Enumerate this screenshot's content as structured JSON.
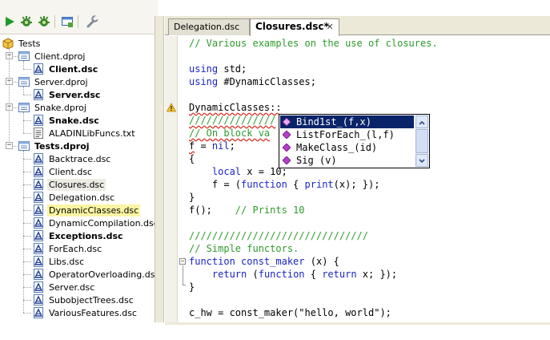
{
  "toolbar": {
    "buttons": [
      {
        "name": "run",
        "icon": "play-icon"
      },
      {
        "name": "debug",
        "icon": "gear-bug-icon"
      },
      {
        "name": "debug2",
        "icon": "gear-bug-icon"
      },
      {
        "name": "window",
        "icon": "window-icon"
      },
      {
        "name": "settings",
        "icon": "wrench-icon"
      }
    ]
  },
  "tree": {
    "items": [
      {
        "label": "Tests",
        "depth": 0,
        "icon": "solution-icon",
        "bold": false,
        "expander": "none"
      },
      {
        "label": "Client.dproj",
        "depth": 1,
        "icon": "project-icon",
        "bold": false,
        "expander": "minus"
      },
      {
        "label": "Client.dsc",
        "depth": 2,
        "icon": "dsc-file-icon",
        "bold": true,
        "expander": "none"
      },
      {
        "label": "Server.dproj",
        "depth": 1,
        "icon": "project-icon",
        "bold": false,
        "expander": "minus"
      },
      {
        "label": "Server.dsc",
        "depth": 2,
        "icon": "dsc-file-icon",
        "bold": true,
        "expander": "none"
      },
      {
        "label": "Snake.dproj",
        "depth": 1,
        "icon": "project-icon",
        "bold": false,
        "expander": "minus"
      },
      {
        "label": "Snake.dsc",
        "depth": 2,
        "icon": "dsc-file-icon",
        "bold": true,
        "expander": "none"
      },
      {
        "label": "ALADINLibFuncs.txt",
        "depth": 2,
        "icon": "text-file-icon",
        "bold": false,
        "expander": "none"
      },
      {
        "label": "Tests.dproj",
        "depth": 1,
        "icon": "project-icon",
        "bold": true,
        "expander": "minus"
      },
      {
        "label": "Backtrace.dsc",
        "depth": 2,
        "icon": "dsc-file-icon",
        "bold": false,
        "expander": "none"
      },
      {
        "label": "Client.dsc",
        "depth": 2,
        "icon": "dsc-file-icon",
        "bold": false,
        "expander": "none"
      },
      {
        "label": "Closures.dsc",
        "depth": 2,
        "icon": "dsc-file-icon",
        "bold": false,
        "expander": "none",
        "state": "selected"
      },
      {
        "label": "Delegation.dsc",
        "depth": 2,
        "icon": "dsc-file-icon",
        "bold": false,
        "expander": "none"
      },
      {
        "label": "DynamicClasses.dsc",
        "depth": 2,
        "icon": "dsc-file-icon",
        "bold": false,
        "expander": "none",
        "state": "highlighted"
      },
      {
        "label": "DynamicCompilation.dsc",
        "depth": 2,
        "icon": "dsc-file-icon",
        "bold": false,
        "expander": "none"
      },
      {
        "label": "Exceptions.dsc",
        "depth": 2,
        "icon": "dsc-file-icon",
        "bold": true,
        "expander": "none"
      },
      {
        "label": "ForEach.dsc",
        "depth": 2,
        "icon": "dsc-file-icon",
        "bold": false,
        "expander": "none"
      },
      {
        "label": "Libs.dsc",
        "depth": 2,
        "icon": "dsc-file-icon",
        "bold": false,
        "expander": "none"
      },
      {
        "label": "OperatorOverloading.dsc",
        "depth": 2,
        "icon": "dsc-file-icon",
        "bold": false,
        "expander": "none"
      },
      {
        "label": "Server.dsc",
        "depth": 2,
        "icon": "dsc-file-icon",
        "bold": false,
        "expander": "none"
      },
      {
        "label": "SubobjectTrees.dsc",
        "depth": 2,
        "icon": "dsc-file-icon",
        "bold": false,
        "expander": "none"
      },
      {
        "label": "VariousFeatures.dsc",
        "depth": 2,
        "icon": "dsc-file-icon",
        "bold": false,
        "expander": "none"
      }
    ]
  },
  "tabs": [
    {
      "label": "Delegation.dsc",
      "active": false
    },
    {
      "label": "Closures.dsc*",
      "active": true,
      "close_glyph": "✕"
    }
  ],
  "code": {
    "lines": [
      [
        {
          "t": "// Various examples on the use of closures.",
          "c": "cm"
        }
      ],
      [],
      [
        {
          "t": "using",
          "c": "kw"
        },
        {
          "t": " std;",
          "c": ""
        }
      ],
      [
        {
          "t": "using",
          "c": "kw"
        },
        {
          "t": " #DynamicClasses;",
          "c": ""
        }
      ],
      [],
      [
        {
          "t": "DynamicClasses::",
          "c": "squig"
        }
      ],
      [
        {
          "t": "///////////////",
          "c": "cm squig"
        }
      ],
      [
        {
          "t": "// On block va",
          "c": "cm squig"
        }
      ],
      [
        {
          "t": "f",
          "c": "squig"
        },
        {
          "t": " = ",
          "c": ""
        },
        {
          "t": "nil",
          "c": "kw"
        },
        {
          "t": ";",
          "c": ""
        }
      ],
      [
        {
          "t": "{",
          "c": ""
        }
      ],
      [
        {
          "t": "    ",
          "c": ""
        },
        {
          "t": "local",
          "c": "kw"
        },
        {
          "t": " x = ",
          "c": ""
        },
        {
          "t": "10",
          "c": "num"
        },
        {
          "t": ";",
          "c": ""
        }
      ],
      [
        {
          "t": "    f = (",
          "c": ""
        },
        {
          "t": "function",
          "c": "kw"
        },
        {
          "t": " { ",
          "c": ""
        },
        {
          "t": "print",
          "c": "kw"
        },
        {
          "t": "(x); });",
          "c": ""
        }
      ],
      [
        {
          "t": "}",
          "c": ""
        }
      ],
      [
        {
          "t": "f();    ",
          "c": ""
        },
        {
          "t": "// Prints 10",
          "c": "cm"
        }
      ],
      [],
      [
        {
          "t": "///////////////////////////////",
          "c": "cm"
        }
      ],
      [
        {
          "t": "// Simple functors.",
          "c": "cm"
        }
      ],
      [
        {
          "t": "function",
          "c": "kw"
        },
        {
          "t": " ",
          "c": ""
        },
        {
          "t": "const_maker",
          "c": "kw"
        },
        {
          "t": " (x) {",
          "c": ""
        }
      ],
      [
        {
          "t": "    ",
          "c": ""
        },
        {
          "t": "return",
          "c": "kw"
        },
        {
          "t": " (",
          "c": ""
        },
        {
          "t": "function",
          "c": "kw"
        },
        {
          "t": " { ",
          "c": ""
        },
        {
          "t": "return",
          "c": "kw"
        },
        {
          "t": " x; });",
          "c": ""
        }
      ],
      [
        {
          "t": "}",
          "c": ""
        }
      ],
      [],
      [
        {
          "t": "c_hw = const_maker(",
          "c": ""
        },
        {
          "t": "\"hello, world\"",
          "c": "str"
        },
        {
          "t": ");",
          "c": ""
        }
      ]
    ]
  },
  "autocomplete": {
    "items": [
      {
        "label": "Bind1st_(f,x)",
        "icon": "method-icon",
        "selected": true
      },
      {
        "label": "ListForEach_(l,f)",
        "icon": "method-icon",
        "selected": false
      },
      {
        "label": "MakeClass_(id)",
        "icon": "method-icon",
        "selected": false
      },
      {
        "label": "Sig (v)",
        "icon": "method-icon",
        "selected": false
      }
    ]
  },
  "colors": {
    "comment": "#2e9a2e",
    "keyword": "#1a23c8",
    "selection": "#0a246a",
    "highlight": "#fbf5a3",
    "error_squiggle": "#d9281d"
  }
}
